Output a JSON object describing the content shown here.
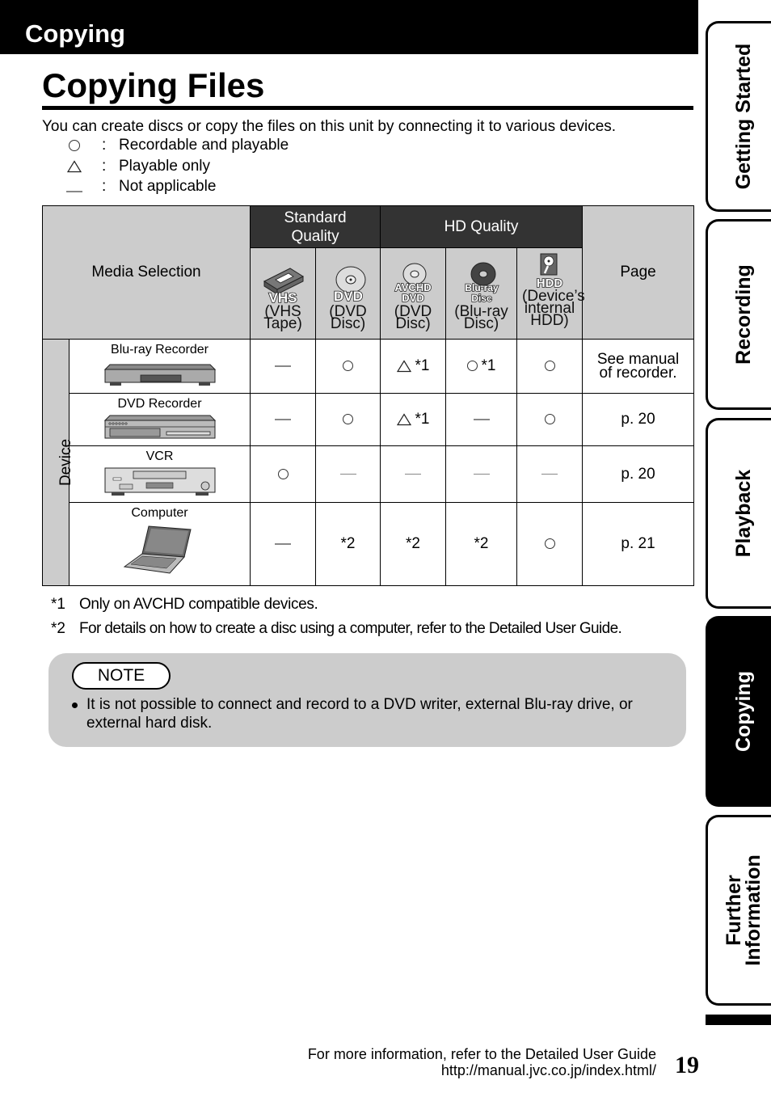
{
  "section": {
    "title": "Copying"
  },
  "page_title": "Copying Files",
  "intro": "You can create discs or copy the files on this unit by connecting it to various devices.",
  "legend": [
    {
      "symbol": "circle",
      "colon": ":",
      "text": "Recordable and playable"
    },
    {
      "symbol": "triangle",
      "colon": ":",
      "text": "Playable only"
    },
    {
      "symbol": "dash",
      "colon": ":",
      "text": "Not applicable"
    }
  ],
  "table": {
    "media_selection_label": "Media Selection",
    "page_label": "Page",
    "device_label": "Device",
    "groups": [
      {
        "label": "Standard Quality"
      },
      {
        "label": "HD Quality"
      }
    ],
    "media": [
      {
        "icon": "vhs-tape-icon",
        "badge": "VHS",
        "desc": "(VHS Tape)"
      },
      {
        "icon": "dvd-disc-icon",
        "badge": "DVD",
        "desc": "(DVD Disc)"
      },
      {
        "icon": "avchd-dvd-icon",
        "badge": "AVCHD DVD",
        "desc": "(DVD Disc)"
      },
      {
        "icon": "blu-ray-disc-icon",
        "badge": "Blu-ray Disc",
        "desc": "(Blu-ray Disc)"
      },
      {
        "icon": "hdd-icon",
        "badge": "HDD",
        "desc": "(Device’s internal HDD)"
      }
    ],
    "rows": [
      {
        "device": "Blu-ray Recorder",
        "icon": "blu-ray-recorder-icon",
        "cells": [
          {
            "sym": "dash",
            "note": ""
          },
          {
            "sym": "circle",
            "note": ""
          },
          {
            "sym": "triangle",
            "note": "*1"
          },
          {
            "sym": "circle",
            "note": "*1"
          },
          {
            "sym": "circle",
            "note": ""
          }
        ],
        "page": "See manual of recorder."
      },
      {
        "device": "DVD Recorder",
        "icon": "dvd-recorder-icon",
        "cells": [
          {
            "sym": "dash",
            "note": ""
          },
          {
            "sym": "circle",
            "note": ""
          },
          {
            "sym": "triangle",
            "note": "*1"
          },
          {
            "sym": "dash",
            "note": ""
          },
          {
            "sym": "circle",
            "note": ""
          }
        ],
        "page": "p. 20"
      },
      {
        "device": "VCR",
        "icon": "vcr-icon",
        "cells": [
          {
            "sym": "circle",
            "note": ""
          },
          {
            "sym": "dash",
            "note": ""
          },
          {
            "sym": "dash",
            "note": ""
          },
          {
            "sym": "dash",
            "note": ""
          },
          {
            "sym": "dash",
            "note": ""
          }
        ],
        "page": "p. 20"
      },
      {
        "device": "Computer",
        "icon": "laptop-icon",
        "cells": [
          {
            "sym": "dash",
            "note": ""
          },
          {
            "sym": "",
            "note": "*2"
          },
          {
            "sym": "",
            "note": "*2"
          },
          {
            "sym": "",
            "note": "*2"
          },
          {
            "sym": "circle",
            "note": ""
          }
        ],
        "page": "p. 21"
      }
    ]
  },
  "footnotes": [
    {
      "mark": "*1",
      "text": "Only on AVCHD compatible devices."
    },
    {
      "mark": "*2",
      "text": "For details on how to create a disc using a computer, refer to the Detailed User Guide."
    }
  ],
  "note": {
    "label": "NOTE",
    "items": [
      "It is not possible to connect and record to a DVD writer, external Blu-ray drive, or external hard disk."
    ]
  },
  "side_tabs": [
    {
      "label": "Getting Started",
      "active": false
    },
    {
      "label": "Recording",
      "active": false
    },
    {
      "label": "Playback",
      "active": false
    },
    {
      "label": "Copying",
      "active": true
    },
    {
      "label": "Further Information",
      "active": false
    }
  ],
  "footer": {
    "line1": "For more information, refer to the Detailed User Guide",
    "line2": "http://manual.jvc.co.jp/index.html/",
    "page_number": "19"
  },
  "colors": {
    "header_dark": "#333333",
    "header_grey": "#cccccc",
    "note_bg": "#cccccc"
  }
}
